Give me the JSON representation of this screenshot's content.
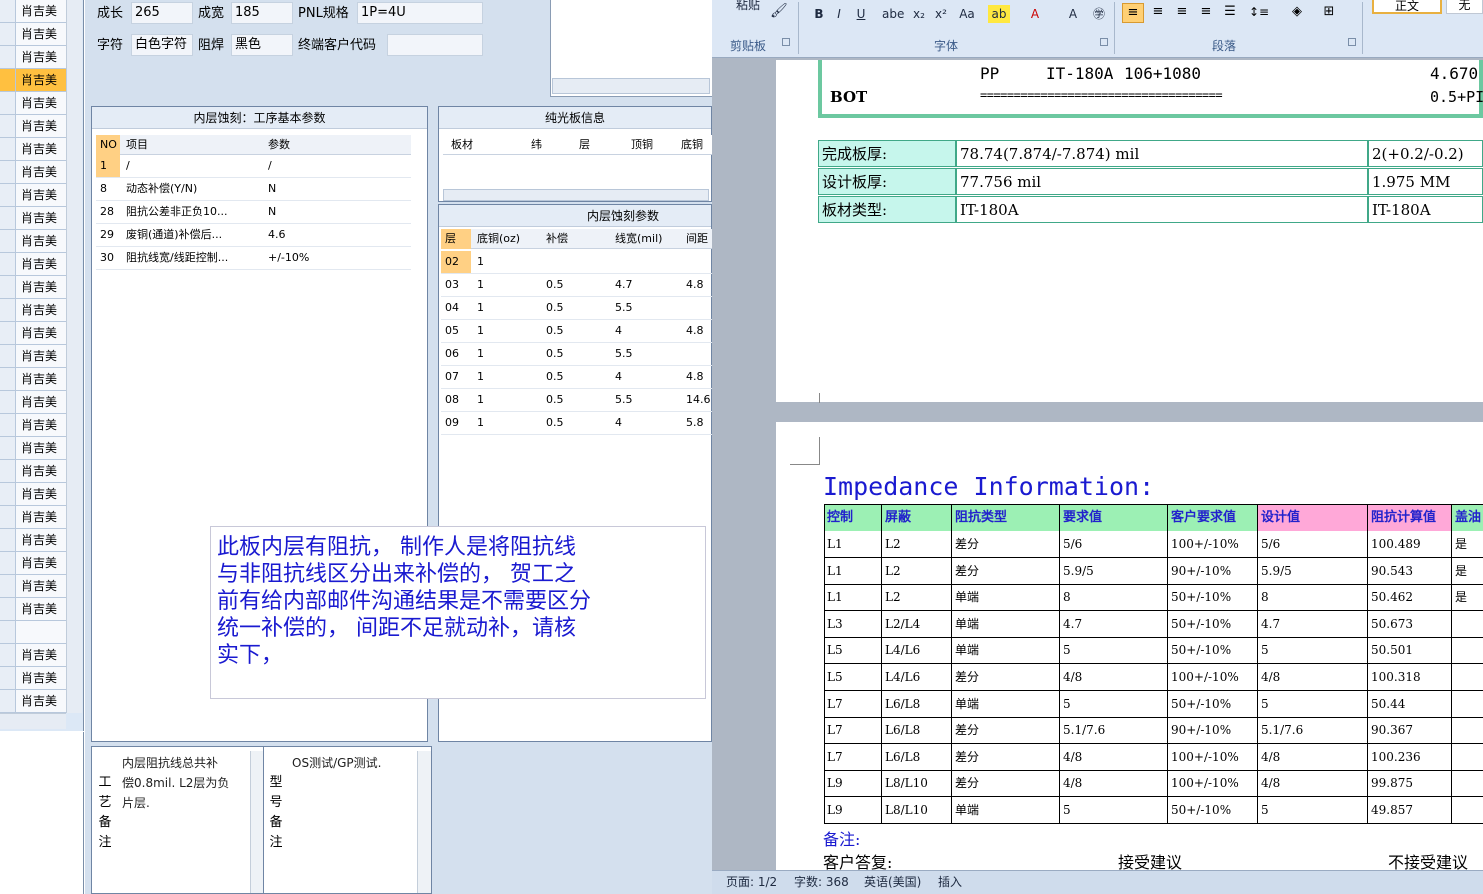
{
  "name_list": {
    "items": [
      "肖吉美",
      "肖吉美",
      "肖吉美",
      "肖吉美",
      "肖吉美",
      "肖吉美",
      "肖吉美",
      "肖吉美",
      "肖吉美",
      "肖吉美",
      "肖吉美",
      "肖吉美",
      "肖吉美",
      "肖吉美",
      "肖吉美",
      "肖吉美",
      "肖吉美",
      "肖吉美",
      "肖吉美",
      "肖吉美",
      "肖吉美",
      "肖吉美",
      "肖吉美",
      "肖吉美",
      "肖吉美",
      "肖吉美",
      "肖吉美",
      "",
      "肖吉美",
      "肖吉美",
      "肖吉美"
    ],
    "highlight_index": 3
  },
  "form": {
    "length_label": "成长",
    "length_value": "265",
    "width_label": "成宽",
    "width_value": "185",
    "pnl_label": "PNL规格",
    "pnl_value": "1P=4U",
    "char_label": "字符",
    "char_value": "白色字符",
    "mask_label": "阻焊",
    "mask_value": "黑色",
    "customer_label": "终端客户代码",
    "customer_value": ""
  },
  "basic_params": {
    "title": "内层蚀刻：工序基本参数",
    "headers": [
      "NO",
      "项目",
      "参数"
    ],
    "rows": [
      [
        "1",
        "/",
        "/"
      ],
      [
        "8",
        "动态补偿(Y/N)",
        "N"
      ],
      [
        "28",
        "阻抗公差非正负10...",
        "N"
      ],
      [
        "29",
        "废铜(通道)补偿后...",
        "4.6"
      ],
      [
        "30",
        "阻抗线宽/线距控制...",
        "+/-10%"
      ]
    ]
  },
  "plain_board": {
    "title": "纯光板信息",
    "headers": [
      "板材",
      "纬",
      "层",
      "顶铜",
      "底铜"
    ]
  },
  "etch_params": {
    "title": "内层蚀刻参数",
    "headers": [
      "层",
      "底铜(oz)",
      "补偿",
      "线宽(mil)",
      "间距"
    ],
    "rows": [
      [
        "02",
        "1",
        "",
        "",
        ""
      ],
      [
        "03",
        "1",
        "0.5",
        "4.7",
        "4.8"
      ],
      [
        "04",
        "1",
        "0.5",
        "5.5",
        ""
      ],
      [
        "05",
        "1",
        "0.5",
        "4",
        "4.8"
      ],
      [
        "06",
        "1",
        "0.5",
        "5.5",
        ""
      ],
      [
        "07",
        "1",
        "0.5",
        "4",
        "4.8"
      ],
      [
        "08",
        "1",
        "0.5",
        "5.5",
        "14.6"
      ],
      [
        "09",
        "1",
        "0.5",
        "4",
        "5.8"
      ]
    ]
  },
  "note": {
    "lines": [
      "此板内层有阻抗， 制作人是将阻抗线",
      "与非阻抗线区分出来补偿的， 贺工之",
      "前有给内部邮件沟通结果是不需要区分",
      "统一补偿的， 间距不足就动补，请核",
      "实下，"
    ]
  },
  "remarks": {
    "process_label": [
      "工",
      "艺",
      "备",
      "注"
    ],
    "process_lines": [
      "内层阻抗线总共补",
      "偿0.8mil. L2层为负",
      "片层."
    ],
    "model_label": [
      "型",
      "号",
      "备",
      "注"
    ],
    "model_text": "OS测试/GP测试."
  },
  "ribbon": {
    "paste_label": "粘贴",
    "clipboard_group": "剪贴板",
    "font_group": "字体",
    "paragraph_group": "段落",
    "style_label": "正文",
    "style_label2": "无",
    "font_buttons": [
      "B",
      "I",
      "U",
      "abe",
      "x₂",
      "x²",
      "Aa",
      "ab",
      "A",
      "A",
      "㊫"
    ]
  },
  "doc_page1": {
    "pp_row": {
      "col1": "PP",
      "col2": "IT-180A",
      "col3": "106+1080",
      "col4": "4.670"
    },
    "bot_row": {
      "col1": "BOT",
      "col2": "====================================",
      "col3": "0.5+PI"
    },
    "summary": [
      [
        "完成板厚:",
        "78.74(7.874/-7.874) mil",
        "2(+0.2/-0.2)"
      ],
      [
        "设计板厚:",
        "77.756 mil",
        "1.975 MM"
      ],
      [
        "板材类型:",
        "IT-180A",
        "IT-180A"
      ]
    ]
  },
  "doc_page2": {
    "heading": "Impedance Information:",
    "headers": [
      "控制",
      "屏蔽",
      "阻抗类型",
      "要求值",
      "客户要求值",
      "设计值",
      "阻抗计算值",
      "盖油"
    ],
    "header_colors": [
      "#9cf0b4",
      "#9cf0b4",
      "#9cf0b4",
      "#9cf0b4",
      "#9cf0b4",
      "#ffa8d8",
      "#ffa8d8",
      "#9cf0b4"
    ],
    "rows": [
      [
        "L1",
        "L2",
        "差分",
        "5/6",
        "100+/-10%",
        "5/6",
        "100.489",
        "是"
      ],
      [
        "L1",
        "L2",
        "差分",
        "5.9/5",
        "90+/-10%",
        "5.9/5",
        "90.543",
        "是"
      ],
      [
        "L1",
        "L2",
        "单端",
        "8",
        "50+/-10%",
        "8",
        "50.462",
        "是"
      ],
      [
        "L3",
        "L2/L4",
        "单端",
        "4.7",
        "50+/-10%",
        "4.7",
        "50.673",
        ""
      ],
      [
        "L5",
        "L4/L6",
        "单端",
        "5",
        "50+/-10%",
        "5",
        "50.501",
        ""
      ],
      [
        "L5",
        "L4/L6",
        "差分",
        "4/8",
        "100+/-10%",
        "4/8",
        "100.318",
        ""
      ],
      [
        "L7",
        "L6/L8",
        "单端",
        "5",
        "50+/-10%",
        "5",
        "50.44",
        ""
      ],
      [
        "L7",
        "L6/L8",
        "差分",
        "5.1/7.6",
        "90+/-10%",
        "5.1/7.6",
        "90.367",
        ""
      ],
      [
        "L7",
        "L6/L8",
        "差分",
        "4/8",
        "100+/-10%",
        "4/8",
        "100.236",
        ""
      ],
      [
        "L9",
        "L8/L10",
        "差分",
        "4/8",
        "100+/-10%",
        "4/8",
        "99.875",
        ""
      ],
      [
        "L9",
        "L8/L10",
        "单端",
        "5",
        "50+/-10%",
        "5",
        "49.857",
        ""
      ]
    ],
    "remark_label": "备注:",
    "reply_label": "客户答复:",
    "accept_label": "接受建议",
    "reject_label": "不接受建议"
  },
  "status": {
    "page": "页面: 1/2",
    "words": "字数: 368",
    "lang": "英语(美国)",
    "mode": "插入"
  }
}
